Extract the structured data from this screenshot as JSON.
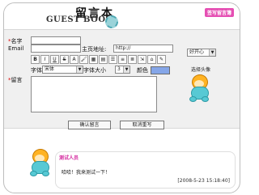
{
  "header": {
    "title_cn": "留言本",
    "title_en": "GUEST BOOK",
    "top_link": "签写留言簿"
  },
  "form": {
    "name_label": "名字",
    "email_label": "Email",
    "homepage_label": "主页地址:",
    "homepage_value": "http://",
    "font_label": "字体",
    "font_value": "宋体",
    "size_label": "字体大小",
    "size_value": "3",
    "color_label": "颜色",
    "message_label": "留言",
    "submit_label": "确认留言",
    "cancel_label": "取消重写",
    "avatar_label": "选择头像",
    "avatar_value": "好开心"
  },
  "toolbar": {
    "buttons": [
      "B",
      "I",
      "U",
      "S",
      "A",
      "🖌",
      "▦",
      "▤",
      "☰",
      "≡",
      "≣",
      "⇲",
      "⌂",
      "✎"
    ]
  },
  "entry": {
    "name": "测试人员",
    "message": "哈哈！我来测试一下！",
    "time": "[2008-5-23 15:18:40]"
  },
  "colors": {
    "accent": "#e54fb3",
    "swatch": "#85a6e8",
    "mascot_body": "#57c9d4",
    "mascot_head": "#ffb323"
  }
}
